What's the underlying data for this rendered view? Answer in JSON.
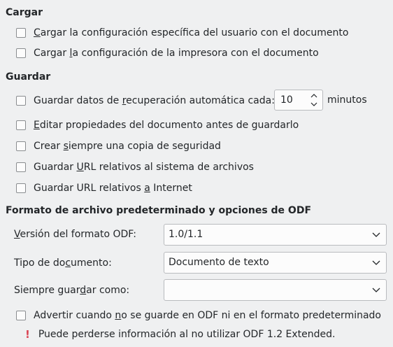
{
  "cargar": {
    "title": "Cargar",
    "items": [
      {
        "pre": "",
        "acc": "C",
        "post": "argar la configuración específica del usuario con el documento"
      },
      {
        "pre": "Cargar ",
        "acc": "l",
        "post": "a configuración de la impresora con el documento"
      }
    ]
  },
  "guardar": {
    "title": "Guardar",
    "autorecovery": {
      "pre": "Guardar datos de ",
      "acc": "r",
      "post": "ecuperación automática cada:",
      "value": "10",
      "unit": "minutos"
    },
    "items": [
      {
        "pre": "",
        "acc": "E",
        "post": "ditar propiedades del documento antes de guardarlo"
      },
      {
        "pre": "Crear ",
        "acc": "s",
        "post": "iempre una copia de seguridad"
      },
      {
        "pre": "Guardar ",
        "acc": "U",
        "post": "RL relativos al sistema de archivos"
      },
      {
        "pre": "Guardar URL relativos ",
        "acc": "a",
        "post": " Internet"
      }
    ]
  },
  "formato": {
    "title": "Formato de archivo predeterminado y opciones de ODF",
    "odf_version": {
      "pre": "",
      "acc": "V",
      "post": "ersión del formato ODF:",
      "value": "1.0/1.1"
    },
    "doc_type": {
      "pre": "Tipo de do",
      "acc": "c",
      "post": "umento:",
      "value": "Documento de texto"
    },
    "always_save": {
      "pre": "Siempre guar",
      "acc": "d",
      "post": "ar como:",
      "value": ""
    },
    "warn": {
      "pre": "Advertir cuando ",
      "acc": "n",
      "post": "o se guarde en ODF ni en el formato predeterminado"
    },
    "info": {
      "icon": "exclamation-icon",
      "text": "Puede perderse información al no utilizar ODF 1.2 Extended."
    }
  }
}
